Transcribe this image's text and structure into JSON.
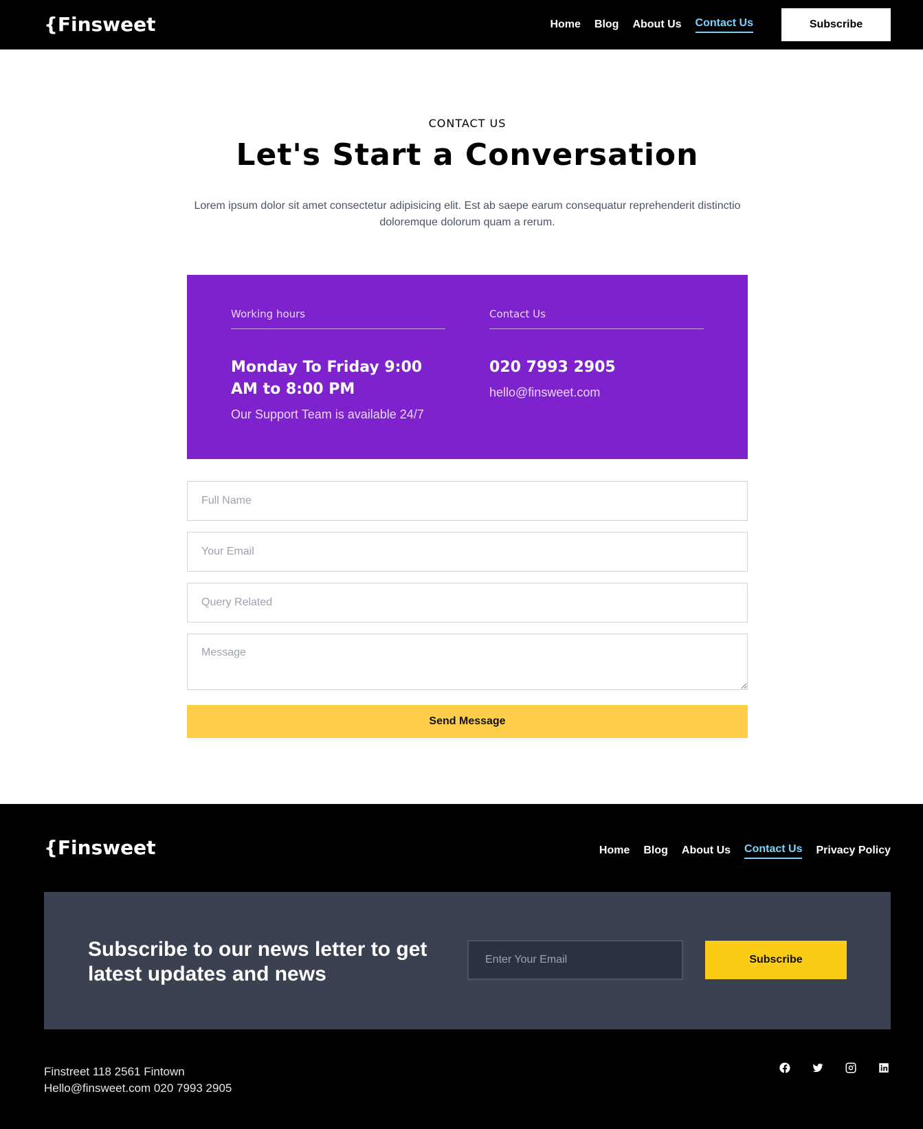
{
  "header": {
    "logo": "{Finsweet",
    "nav": [
      "Home",
      "Blog",
      "About Us",
      "Contact Us"
    ],
    "active_nav": "Contact Us",
    "subscribe_label": "Subscribe"
  },
  "hero": {
    "eyebrow": "CONTACT US",
    "title": "Let's Start a Conversation",
    "intro": "Lorem ipsum dolor sit amet consectetur adipisicing elit. Est ab saepe earum consequatur reprehenderit distinctio doloremque dolorum quam a rerum."
  },
  "info": {
    "hours_label": "Working hours",
    "hours_value": "Monday To Friday 9:00 AM to 8:00 PM",
    "hours_note": "Our Support Team is available 24/7",
    "contact_label": "Contact Us",
    "phone": "020 7993 2905",
    "email": "hello@finsweet.com"
  },
  "form": {
    "name_placeholder": "Full Name",
    "email_placeholder": "Your Email",
    "query_placeholder": "Query Related",
    "message_placeholder": "Message",
    "submit_label": "Send Message"
  },
  "footer": {
    "logo": "{Finsweet",
    "nav": [
      "Home",
      "Blog",
      "About Us",
      "Contact Us",
      "Privacy Policy"
    ],
    "active_nav": "Contact Us",
    "newsletter_title": "Subscribe to our news letter to get latest updates and news",
    "newsletter_placeholder": "Enter Your Email",
    "newsletter_button": "Subscribe",
    "address_line1": "Finstreet 118 2561 Fintown",
    "address_line2": "Hello@finsweet.com 020 7993 2905",
    "socials": [
      "facebook-icon",
      "twitter-icon",
      "instagram-icon",
      "linkedin-icon"
    ]
  },
  "colors": {
    "purple": "#7e22ce",
    "yellow": "#fecd4a",
    "accent_link": "#7dd3fc",
    "newsletter_bg": "#3a4150"
  }
}
